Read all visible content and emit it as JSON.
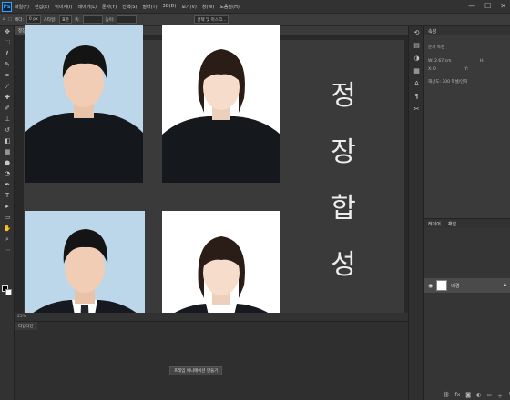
{
  "menubar": {
    "logo": "Ps",
    "items": [
      "파일(F)",
      "편집(E)",
      "이미지(I)",
      "레이어(L)",
      "문자(Y)",
      "선택(S)",
      "필터(T)",
      "3D(D)",
      "보기(V)",
      "창(W)",
      "도움말(H)"
    ],
    "window_controls": [
      "—",
      "☐",
      "✕"
    ]
  },
  "options": {
    "feather_label": "페더:",
    "feather_value": "0 px",
    "style_label": "스타일:",
    "style_value": "표준",
    "width_label": "폭:",
    "height_label": "높이:",
    "select_mask_button": "선택 및 마스크..."
  },
  "document": {
    "tab_label": "정장합성.psd @ 25% (레이어 1, RGB/8)",
    "status_text": "25%",
    "hangul_chars": [
      "정",
      "장",
      "합",
      "성"
    ]
  },
  "timeline": {
    "tab_label": "타임라인",
    "create_button": "프레임 애니메이션 만들기"
  },
  "properties": {
    "tabs": [
      "속성"
    ],
    "doc_props_label": "문서 속성",
    "width_label": "W:",
    "width_value": "2.67 cm",
    "height_label": "H:",
    "x_label": "X:",
    "x_value": "0",
    "y_label": "Y:",
    "resolution": "해상도: 300 픽셀/인치"
  },
  "layers": {
    "tabs": [
      "레이어",
      "채널"
    ],
    "layer_name": "배경"
  }
}
